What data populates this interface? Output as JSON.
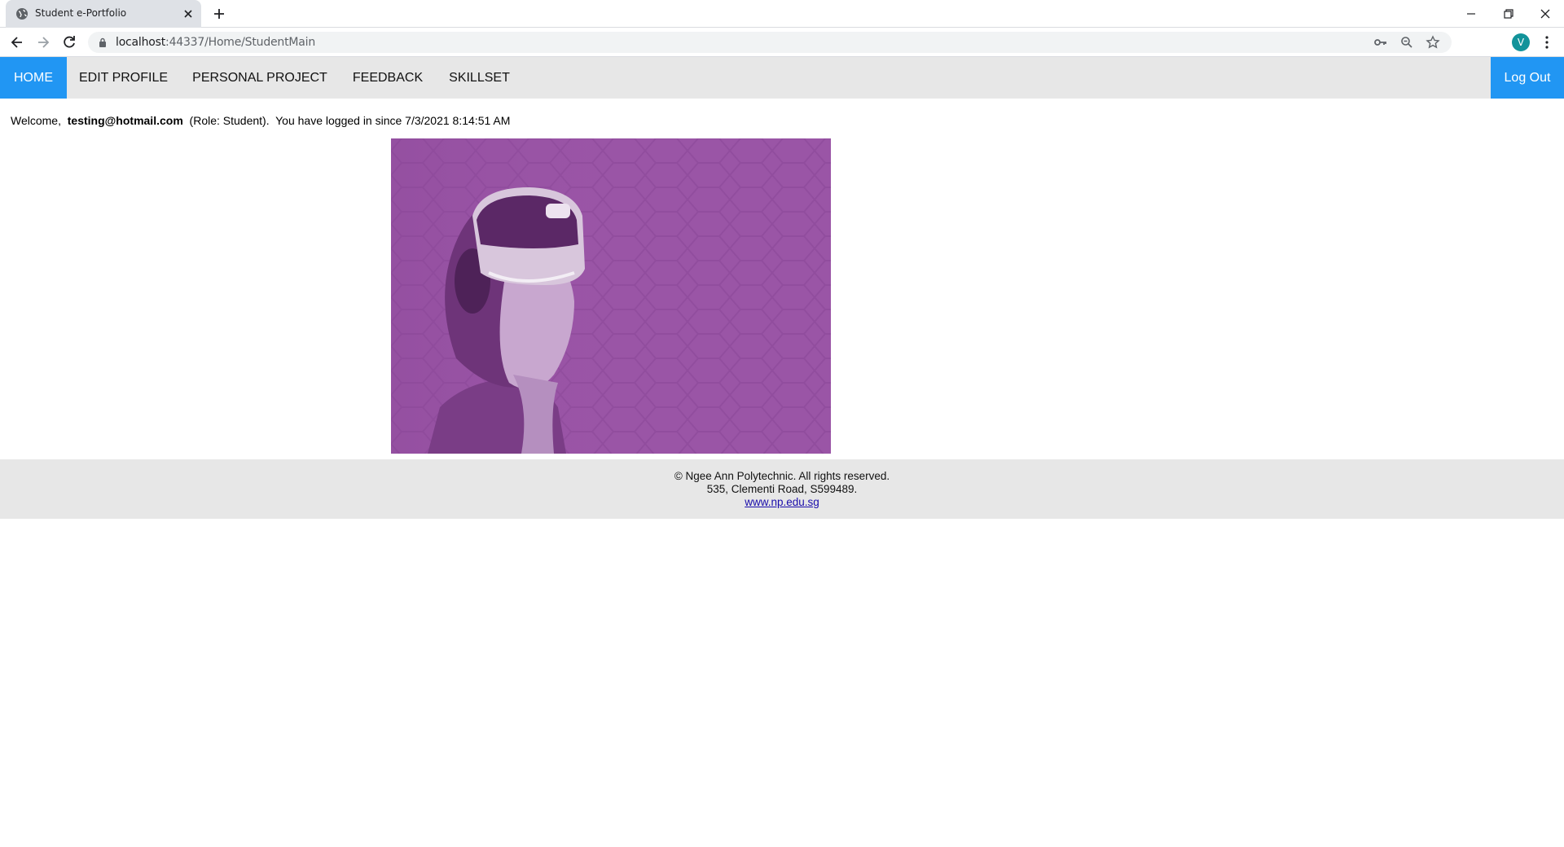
{
  "browser": {
    "tab_title": "Student e-Portfolio",
    "url_host": "localhost",
    "url_rest": ":44337/Home/StudentMain",
    "profile_initial": "V"
  },
  "nav": {
    "items": [
      "HOME",
      "EDIT PROFILE",
      "PERSONAL PROJECT",
      "FEEDBACK",
      "SKILLSET"
    ],
    "active": "HOME",
    "logout": "Log Out"
  },
  "welcome": {
    "prefix": "Welcome,  ",
    "email": "testing@hotmail.com",
    "suffix": "  (Role: Student).  You have logged in since 7/3/2021 8:14:51 AM"
  },
  "hero": {
    "alt": "Student wearing VR headset",
    "tint": "#9a55a6"
  },
  "footer": {
    "copyright": "© Ngee Ann Polytechnic. All rights reserved.",
    "address": "535, Clementi Road, S599489.",
    "link": "www.np.edu.sg"
  },
  "colors": {
    "accent": "#2196f3",
    "navbar_bg": "#e7e7e7"
  }
}
